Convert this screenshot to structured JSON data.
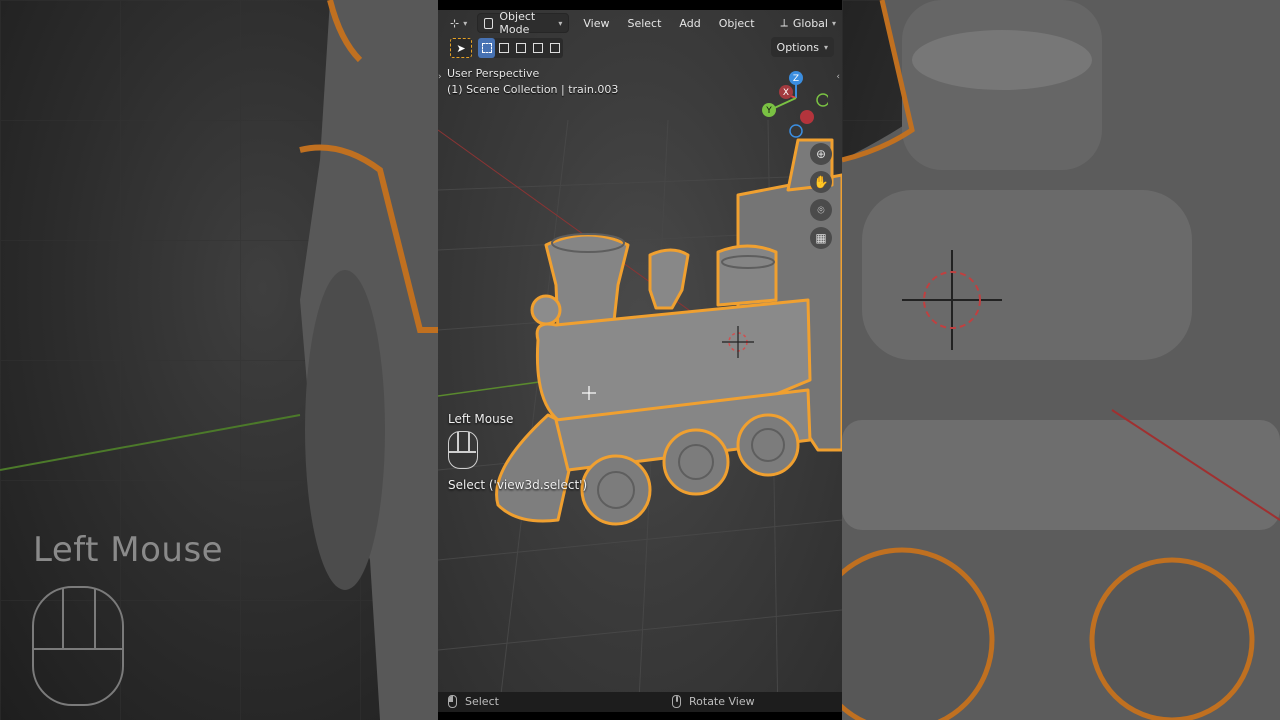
{
  "header": {
    "editor_type_icon": "axes-editor-icon",
    "mode_label": "Object Mode",
    "menus": [
      "View",
      "Select",
      "Add",
      "Object"
    ],
    "transform_orientation": "Global"
  },
  "toolbar": {
    "options_label": "Options"
  },
  "viewport": {
    "view_name": "User Perspective",
    "collection_info": "(1) Scene Collection | train.003"
  },
  "gizmo": {
    "axes": [
      "Z",
      "X",
      "Y"
    ],
    "colors": {
      "x": "#e0434a",
      "y": "#7ac143",
      "z": "#3b8ee0",
      "selection_outline": "#f0a030"
    }
  },
  "nav_buttons": [
    "zoom-icon",
    "hand-pan-icon",
    "camera-icon",
    "grid-ortho-icon"
  ],
  "keycast": {
    "key_label": "Left Mouse",
    "operator_label": "Select ('view3d.select')"
  },
  "side_overlay": {
    "key_label": "Left Mouse"
  },
  "statusbar": {
    "left_label": "Select",
    "middle_label": "Rotate View"
  }
}
